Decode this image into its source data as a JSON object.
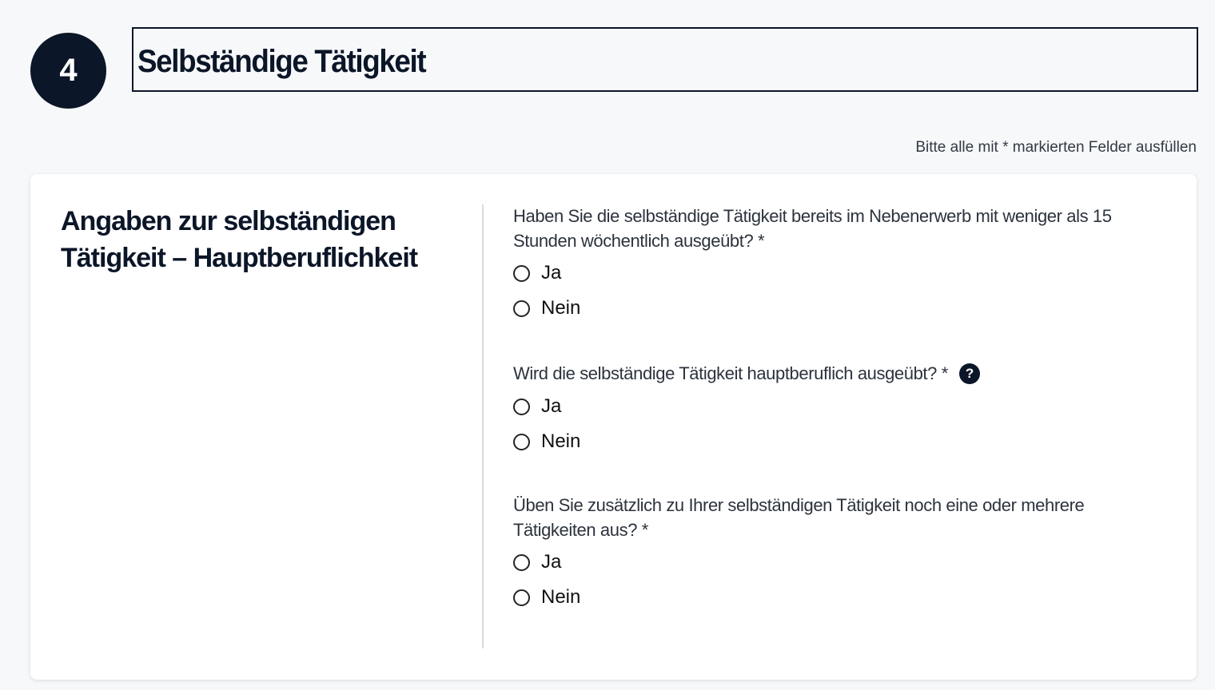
{
  "step": {
    "number": "4",
    "title": "Selbständige Tätigkeit"
  },
  "required_note": "Bitte alle mit * markierten Felder ausfüllen",
  "section": {
    "heading": "Angaben zur selbständigen Tätigkeit – Hauptberuflichkeit"
  },
  "questions": [
    {
      "text": "Haben Sie die selbständige Tätigkeit bereits im Nebenerwerb mit weniger als 15 Stunden wöchentlich ausgeübt? *",
      "options": [
        "Ja",
        "Nein"
      ],
      "selected": null
    },
    {
      "text": "Wird die selbständige Tätigkeit hauptberuflich ausgeübt? *",
      "help_icon": "?",
      "options": [
        "Ja",
        "Nein"
      ],
      "selected": null
    },
    {
      "text": "Üben Sie zusätzlich zu Ihrer selbständigen Tätigkeit noch eine oder mehrere Tätigkeiten aus? *",
      "options": [
        "Ja",
        "Nein"
      ],
      "selected": null
    }
  ],
  "colors": {
    "brand_dark": "#0b1628",
    "background": "#f7f8fa",
    "card": "#ffffff"
  }
}
